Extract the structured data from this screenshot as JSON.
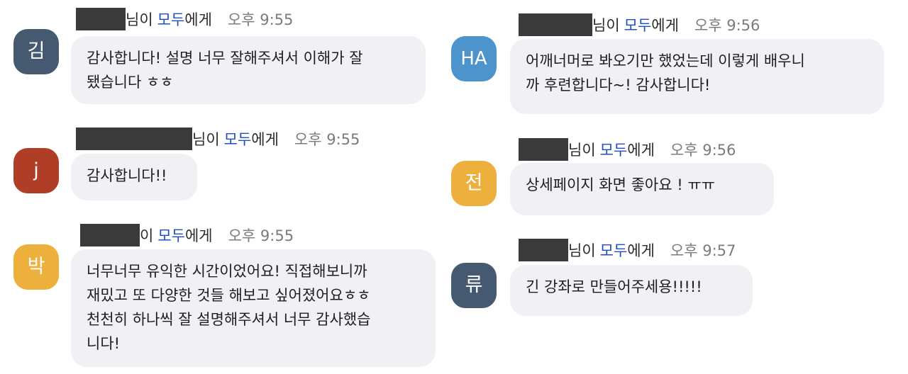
{
  "colors": {
    "avatar_kim": "#455a70",
    "avatar_j": "#b03d26",
    "avatar_park": "#eeb03c",
    "avatar_ha": "#4d93cc",
    "avatar_jeon": "#eeb03c",
    "avatar_ryu": "#455a70",
    "bubble_bg": "#f1f1f5",
    "recipient_link": "#1f4fbf",
    "redaction": "#3a3a3a"
  },
  "messages": [
    {
      "avatar": "김",
      "suffix": "님이",
      "recipient": "모두",
      "recipient_suffix": "에게",
      "time": "오후 9:55",
      "lines": [
        "감사합니다! 설명 너무 잘해주셔서 이해가 잘",
        "됐습니다 ㅎㅎ"
      ]
    },
    {
      "avatar": "j",
      "suffix": "님이",
      "recipient": "모두",
      "recipient_suffix": "에게",
      "time": "오후 9:55",
      "lines": [
        "감사합니다!!"
      ]
    },
    {
      "avatar": "박",
      "suffix": "이",
      "recipient": "모두",
      "recipient_suffix": "에게",
      "time": "오후 9:55",
      "lines": [
        "너무너무 유익한 시간이었어요! 직접해보니까",
        "재밌고 또 다양한 것들 해보고 싶어졌어요ㅎㅎ",
        "천천히 하나씩 잘 설명해주셔서 너무 감사했습",
        "니다!"
      ]
    },
    {
      "avatar": "HA",
      "suffix": "님이",
      "recipient": "모두",
      "recipient_suffix": "에게",
      "time": "오후 9:56",
      "lines": [
        "어깨너머로 봐오기만 했었는데 이렇게 배우니",
        "까 후련합니다~! 감사합니다!"
      ]
    },
    {
      "avatar": "전",
      "suffix": "님이",
      "recipient": "모두",
      "recipient_suffix": "에게",
      "time": "오후 9:56",
      "lines": [
        "상세페이지 화면 좋아요 ! ㅠㅠ"
      ]
    },
    {
      "avatar": "류",
      "suffix": "님이",
      "recipient": "모두",
      "recipient_suffix": "에게",
      "time": "오후 9:57",
      "lines": [
        "긴 강좌로 만들어주세용!!!!!"
      ]
    }
  ]
}
